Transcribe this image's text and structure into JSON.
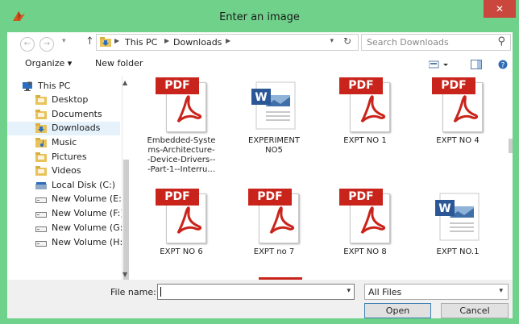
{
  "window": {
    "title": "Enter an image"
  },
  "address": {
    "crumbs": [
      "This PC",
      "Downloads"
    ],
    "search_placeholder": "Search Downloads"
  },
  "toolbar": {
    "organize": "Organize ▾",
    "new_folder": "New folder"
  },
  "nav": [
    {
      "label": "This PC",
      "icon": "computer-icon"
    },
    {
      "label": "Desktop",
      "icon": "folder-icon"
    },
    {
      "label": "Documents",
      "icon": "folder-icon"
    },
    {
      "label": "Downloads",
      "icon": "downloads-folder-icon",
      "selected": true
    },
    {
      "label": "Music",
      "icon": "music-folder-icon"
    },
    {
      "label": "Pictures",
      "icon": "folder-icon"
    },
    {
      "label": "Videos",
      "icon": "folder-icon"
    },
    {
      "label": "Local Disk (C:)",
      "icon": "disk-icon"
    },
    {
      "label": "New Volume (E:)",
      "icon": "drive-icon"
    },
    {
      "label": "New Volume (F:)",
      "icon": "drive-icon"
    },
    {
      "label": "New Volume (G:)",
      "icon": "drive-icon"
    },
    {
      "label": "New Volume (H:)",
      "icon": "drive-icon"
    }
  ],
  "files": [
    {
      "name": "Embedded-Systems-Architecture--Device-Drivers---Part-1--Interru...",
      "type": "pdf",
      "lines": [
        "Embedded-Syste",
        "ms-Architecture-",
        "-Device-Drivers--",
        "-Part-1--Interru..."
      ]
    },
    {
      "name": "EXPERIMENT NO5",
      "type": "word",
      "lines": [
        "EXPERIMENT",
        "NO5"
      ]
    },
    {
      "name": "EXPT NO 1",
      "type": "pdf",
      "lines": [
        "EXPT NO 1"
      ]
    },
    {
      "name": "EXPT NO 4",
      "type": "pdf",
      "lines": [
        "EXPT NO 4"
      ]
    },
    {
      "name": "EXPT NO 6",
      "type": "pdf",
      "lines": [
        "EXPT NO 6"
      ]
    },
    {
      "name": "EXPT no 7",
      "type": "pdf",
      "lines": [
        "EXPT no 7"
      ]
    },
    {
      "name": "EXPT NO 8",
      "type": "pdf",
      "lines": [
        "EXPT NO 8"
      ]
    },
    {
      "name": "EXPT NO.1",
      "type": "word",
      "lines": [
        "EXPT NO.1"
      ]
    }
  ],
  "pdf_badge": "PDF",
  "word_badge": "W",
  "bottom": {
    "file_name_label": "File name:",
    "file_name_value": "",
    "file_type": "All Files",
    "open": "Open",
    "cancel": "Cancel"
  },
  "colors": {
    "pdf_red": "#c9241b",
    "selection": "#e5f1fb",
    "title_bar": "#6fd18a",
    "word_blue": "#2b5797"
  }
}
